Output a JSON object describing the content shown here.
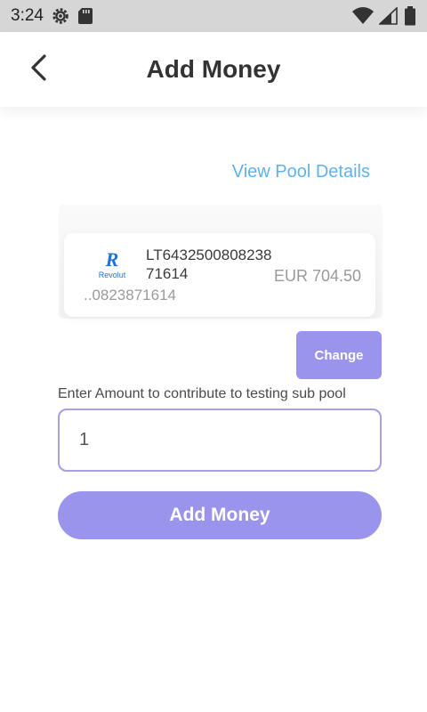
{
  "status_bar": {
    "time": "3:24",
    "icons": [
      "settings-gear-icon",
      "sd-card-icon",
      "wifi-icon",
      "cell-signal-icon",
      "battery-icon"
    ]
  },
  "header": {
    "title": "Add Money",
    "back_icon": "chevron-left-icon"
  },
  "pool": {
    "view_details_label": "View Pool Details"
  },
  "account": {
    "bank_logo_letter": "R",
    "bank_logo_name": "Revolut",
    "account_number": "LT643250080823871614",
    "account_short": "..0823871614",
    "balance": "EUR 704.50",
    "change_label": "Change"
  },
  "amount": {
    "label": "Enter Amount to contribute to testing sub pool",
    "value": "1"
  },
  "actions": {
    "add_money_label": "Add Money"
  },
  "colors": {
    "accent": "#9b94ec",
    "link": "#5fb3ec",
    "input_border": "#a79ee6",
    "status_bar_bg": "#d6d6d6"
  }
}
